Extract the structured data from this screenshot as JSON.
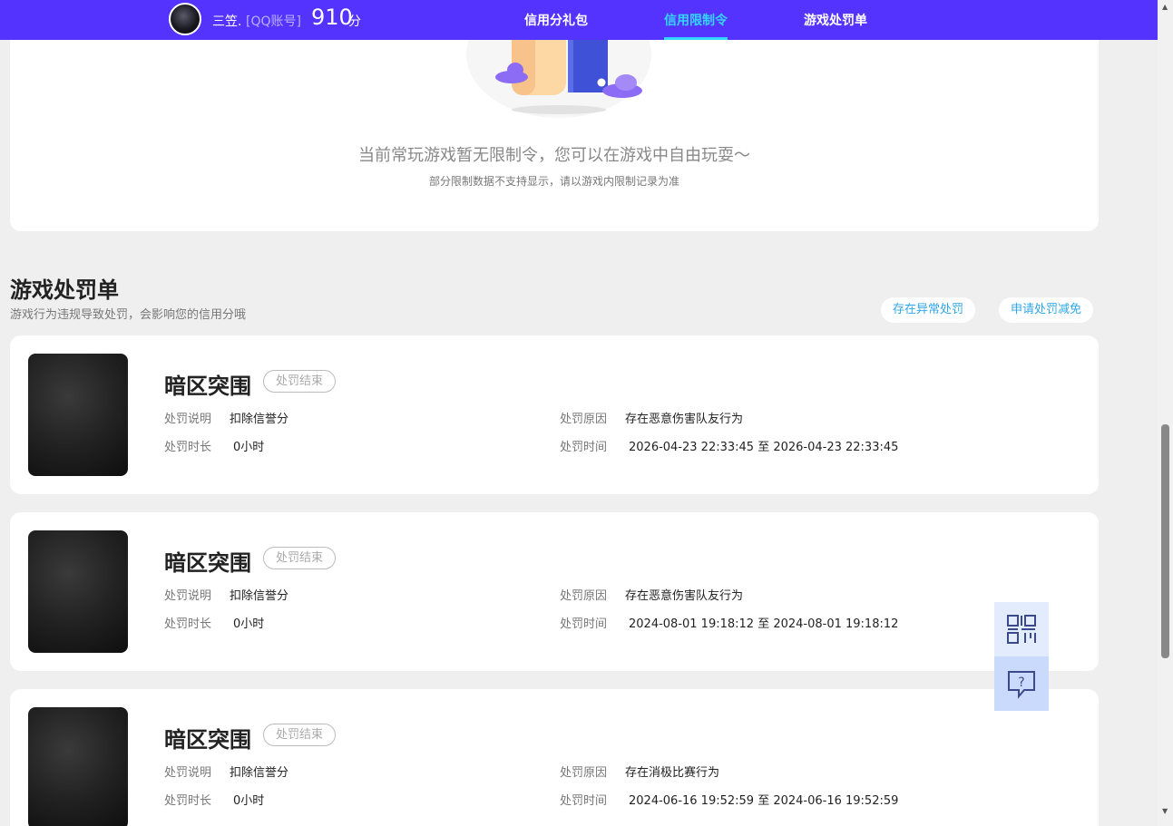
{
  "header": {
    "username": "三笠.",
    "account_type": "[QQ账号]",
    "score": "910",
    "score_unit": "分",
    "nav": [
      "信用分礼包",
      "信用限制令",
      "游戏处罚单"
    ],
    "active_nav_index": 1
  },
  "restriction": {
    "empty_text": "当前常玩游戏暂无限制令，您可以在游戏中自由玩耍～",
    "note": "部分限制数据不支持显示，请以游戏内限制记录为准"
  },
  "punishment": {
    "title": "游戏处罚单",
    "subtitle": "游戏行为违规导致处罚，会影响您的信用分哦",
    "buttons": [
      "存在异常处罚",
      "申请处罚减免"
    ],
    "labels": {
      "desc": "处罚说明",
      "reason": "处罚原因",
      "duration": "处罚时长",
      "time": "处罚时间"
    },
    "records": [
      {
        "game": "暗区突围",
        "status": "处罚结束",
        "desc": "扣除信誉分",
        "reason": "存在恶意伤害队友行为",
        "duration": "0小时",
        "time": "2026-04-23 22:33:45 至 2026-04-23 22:33:45"
      },
      {
        "game": "暗区突围",
        "status": "处罚结束",
        "desc": "扣除信誉分",
        "reason": "存在恶意伤害队友行为",
        "duration": "0小时",
        "time": "2024-08-01 19:18:12 至 2024-08-01 19:18:12"
      },
      {
        "game": "暗区突围",
        "status": "处罚结束",
        "desc": "扣除信誉分",
        "reason": "存在消极比赛行为",
        "duration": "0小时",
        "time": "2024-06-16 19:52:59 至 2024-06-16 19:52:59"
      }
    ]
  },
  "float_panel": {
    "icons": [
      "qr-code-icon",
      "help-chat-icon"
    ]
  },
  "colors": {
    "header_bg": "#5533ff",
    "active_nav": "#33d6ff",
    "page_bg": "#efefef",
    "pill_text": "#2fa7e8"
  }
}
